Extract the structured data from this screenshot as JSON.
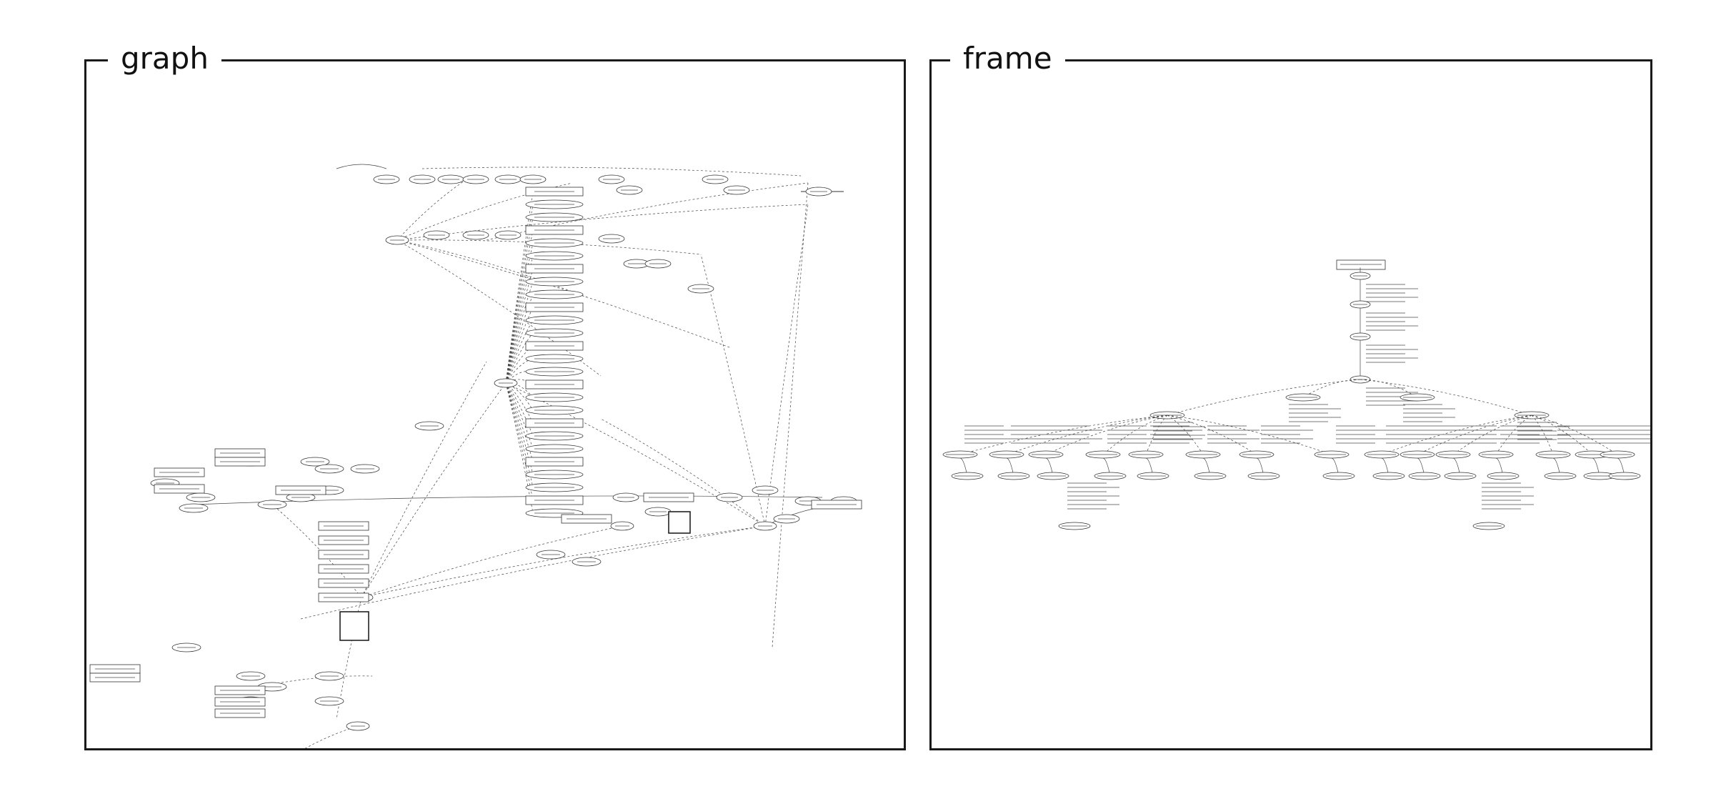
{
  "panels": {
    "graph": {
      "label": "graph"
    },
    "frame": {
      "label": "frame"
    }
  }
}
